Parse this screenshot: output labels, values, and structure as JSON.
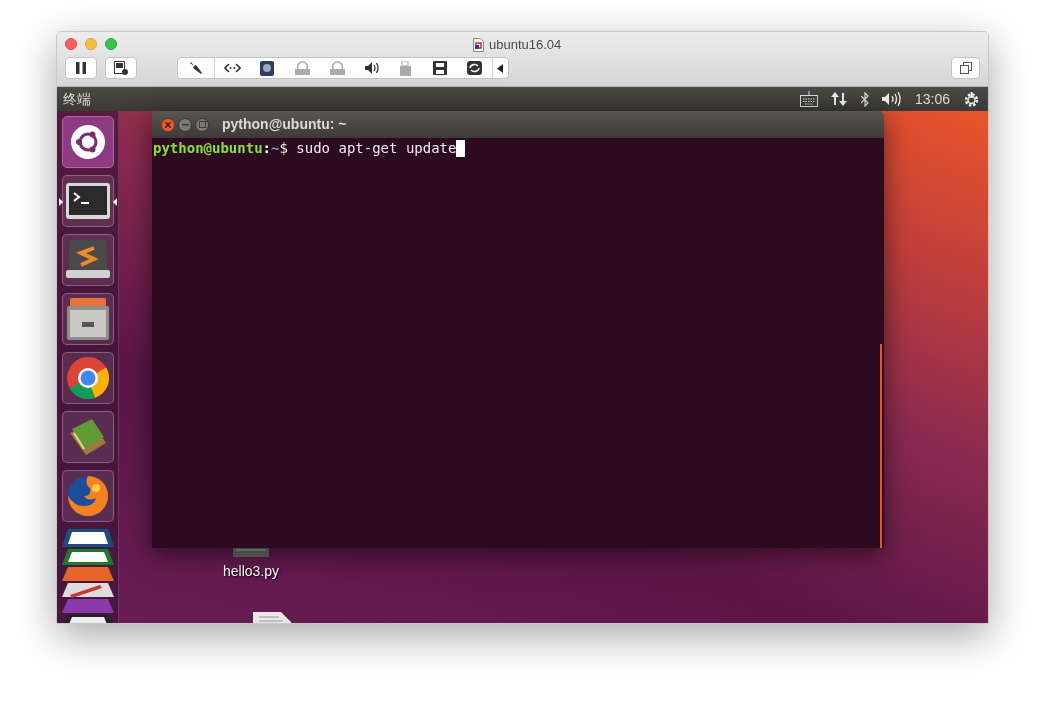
{
  "window": {
    "title": "ubuntu16.04"
  },
  "top_panel": {
    "app_title": "终端",
    "clock": "13:06"
  },
  "launcher": {
    "items": [
      {
        "kind": "ubuntu",
        "selected": false
      },
      {
        "kind": "terminal",
        "selected": true
      },
      {
        "kind": "editor",
        "selected": false
      },
      {
        "kind": "files",
        "selected": false
      },
      {
        "kind": "chrome",
        "selected": false
      },
      {
        "kind": "books",
        "selected": false
      },
      {
        "kind": "firefox",
        "selected": false
      },
      {
        "kind": "stack",
        "selected": false
      }
    ]
  },
  "terminal": {
    "title": "python@ubuntu: ~",
    "prompt_user": "python@ubuntu",
    "prompt_separator": ":",
    "prompt_path": "~",
    "prompt_symbol": "$",
    "command": "sudo apt-get update"
  },
  "desktop_icons": [
    {
      "label": "hello3.py"
    }
  ]
}
